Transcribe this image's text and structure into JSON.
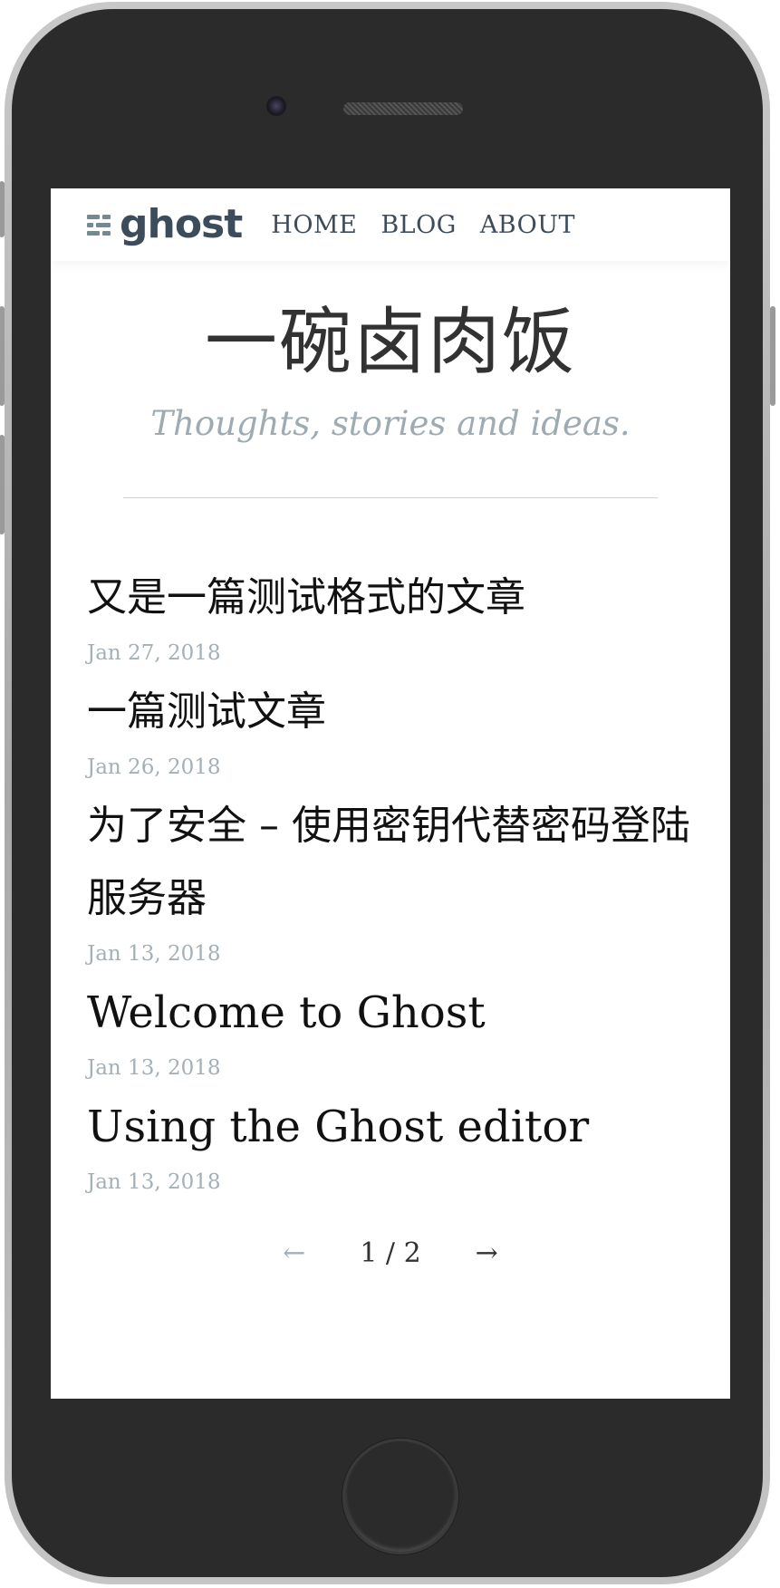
{
  "nav": {
    "logo_text": "ghost",
    "links": [
      "HOME",
      "BLOG",
      "ABOUT"
    ]
  },
  "header": {
    "title": "一碗卤肉饭",
    "description": "Thoughts, stories and ideas."
  },
  "posts": [
    {
      "title": "又是一篇测试格式的文章",
      "date": "Jan 27, 2018"
    },
    {
      "title": "一篇测试文章",
      "date": "Jan 26, 2018"
    },
    {
      "title": "为了安全 – 使用密钥代替密码登陆服务器",
      "date": "Jan 13, 2018"
    },
    {
      "title": "Welcome to Ghost",
      "date": "Jan 13, 2018"
    },
    {
      "title": "Using the Ghost editor",
      "date": "Jan 13, 2018"
    }
  ],
  "pagination": {
    "prev_icon": "←",
    "count": "1 / 2",
    "next_icon": "→"
  },
  "colors": {
    "text_dark": "#323232",
    "nav_text": "#3d4c5b",
    "muted": "#a3b0b8",
    "device_body": "#2b2b2b"
  }
}
